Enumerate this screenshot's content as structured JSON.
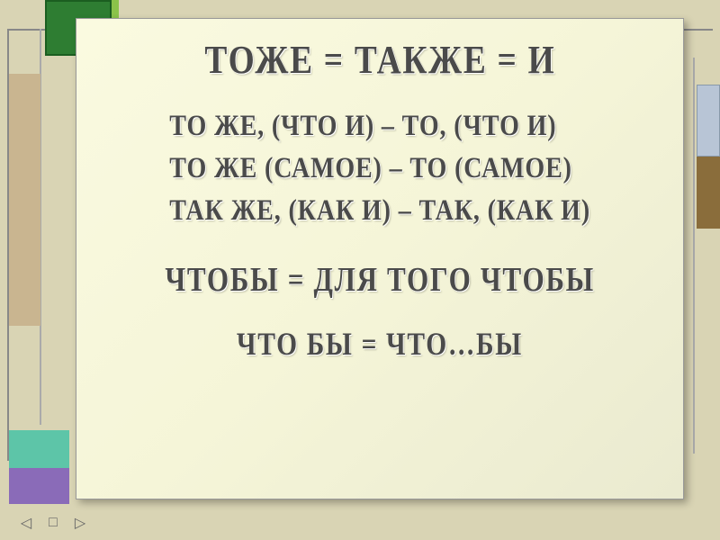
{
  "title": "ТОЖЕ = ТАКЖЕ = И",
  "rules": [
    "ТО  ЖЕ, (ЧТО И) – ТО, (ЧТО И)",
    "ТО  ЖЕ (САМОЕ) – ТО (САМОЕ)",
    "ТАК  ЖЕ, (КАК И) – ТАК, (КАК И)"
  ],
  "subtitle1": "ЧТОБЫ = ДЛЯ ТОГО ЧТОБЫ",
  "subtitle2": "ЧТО  БЫ = ЧТО…БЫ",
  "nav": {
    "prev": "◁",
    "reset": "□",
    "next": "▷"
  }
}
